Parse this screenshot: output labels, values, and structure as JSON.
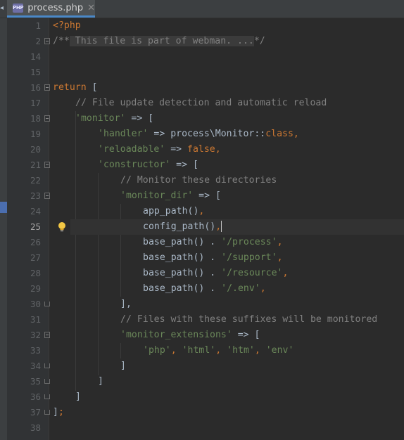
{
  "tab": {
    "icon_label": "PHP",
    "title": "process.php",
    "close": "✕"
  },
  "line_numbers": [
    "1",
    "2",
    "14",
    "15",
    "16",
    "17",
    "18",
    "19",
    "20",
    "21",
    "22",
    "23",
    "24",
    "25",
    "26",
    "27",
    "28",
    "29",
    "30",
    "31",
    "32",
    "33",
    "34",
    "35",
    "36",
    "37",
    "38"
  ],
  "current_line": "25",
  "code": {
    "l1_open": "<?php",
    "l2_start": "/**",
    "l2_folded": " This file is part of webman. ...",
    "l2_end": "*/",
    "l16_return": "return",
    "l16_bracket": " [",
    "l17_comment": "// File update detection and automatic reload",
    "l18_key": "'monitor'",
    "l18_rest": " => [",
    "l19_key": "'handler'",
    "l19_arrow": " => ",
    "l19_class": "process\\Monitor",
    "l19_dc": "::",
    "l19_kw": "class",
    "l19_comma": ",",
    "l20_key": "'reloadable'",
    "l20_arrow": " => ",
    "l20_val": "false",
    "l20_comma": ",",
    "l21_key": "'constructor'",
    "l21_rest": " => [",
    "l22_comment": "// Monitor these directories",
    "l23_key": "'monitor_dir'",
    "l23_rest": " => [",
    "l24_fn": "app_path()",
    "l24_comma": ",",
    "l25_fn": "config_path()",
    "l25_comma": ",",
    "l26_fn": "base_path() . ",
    "l26_str": "'/process'",
    "l26_comma": ",",
    "l27_fn": "base_path() . ",
    "l27_str": "'/support'",
    "l27_comma": ",",
    "l28_fn": "base_path() . ",
    "l28_str": "'/resource'",
    "l28_comma": ",",
    "l29_fn": "base_path() . ",
    "l29_str": "'/.env'",
    "l29_comma": ",",
    "l30": "],",
    "l31_comment": "// Files with these suffixes will be monitored",
    "l32_key": "'monitor_extensions'",
    "l32_rest": " => [",
    "l33_s1": "'php'",
    "l33_s2": "'html'",
    "l33_s3": "'htm'",
    "l33_s4": "'env'",
    "l33_sep": ", ",
    "l34": "]",
    "l35": "]",
    "l36": "]",
    "l37_bracket": "]",
    "l37_semi": ";"
  },
  "colors": {
    "keyword": "#cc7832",
    "string": "#6a8759",
    "comment": "#808080",
    "text": "#a9b7c6",
    "tab_underline": "#4a88c7"
  },
  "icons": {
    "tab_icon": "php-file-icon",
    "bulb": "lightbulb-icon",
    "close": "close-icon"
  }
}
